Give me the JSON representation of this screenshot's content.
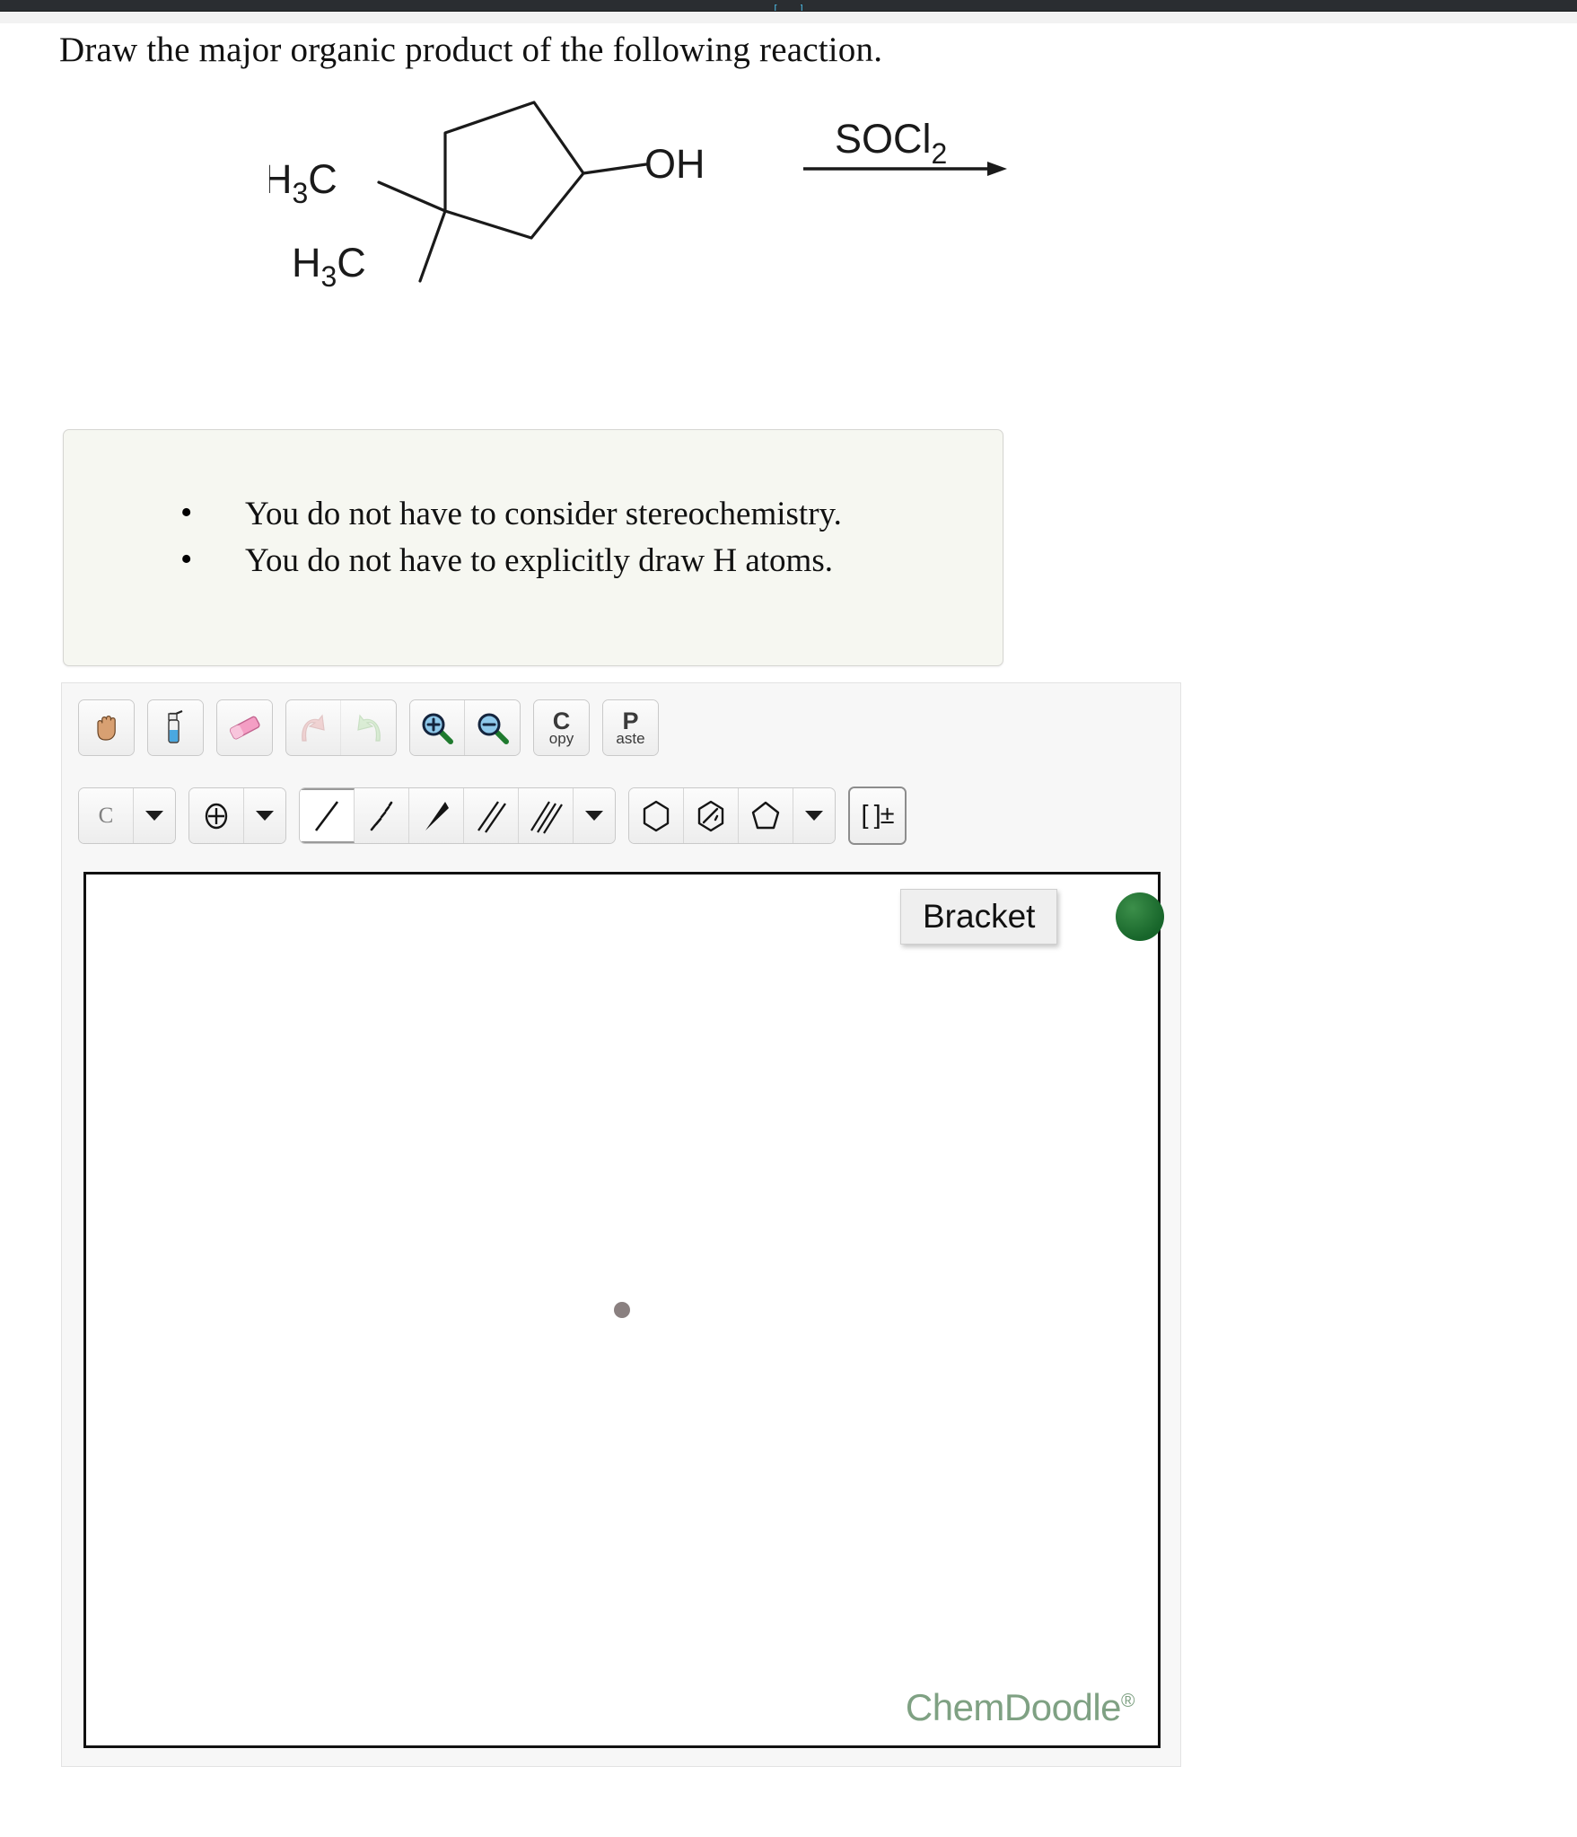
{
  "topbar": {
    "fragments": [
      "[",
      "",
      "",
      "",
      "",
      "",
      "",
      "]"
    ]
  },
  "prompt": {
    "text": "Draw the major organic product of the following reaction."
  },
  "reaction": {
    "substrate_labels": [
      "H3C",
      "H3C",
      "OH"
    ],
    "substrate_label_1_main": "H",
    "substrate_label_1_sub": "3",
    "substrate_label_1_tail": "C",
    "hydroxyl": "OH",
    "reagent_main": "SOCl",
    "reagent_sub": "2",
    "reagent_full": "SOCl2"
  },
  "notes": {
    "bullets": [
      "You do not have to consider stereochemistry.",
      "You do not have to explicitly draw H atoms."
    ]
  },
  "sketcher": {
    "toolbar_row1": [
      {
        "name": "hand-icon",
        "tip": "Move"
      },
      {
        "name": "spray-bottle-icon",
        "tip": "Clear"
      },
      {
        "name": "eraser-icon",
        "tip": "Erase"
      },
      {
        "name": "undo-arrow-icon",
        "tip": "Undo"
      },
      {
        "name": "redo-arrow-icon",
        "tip": "Redo"
      },
      {
        "name": "zoom-in-icon",
        "tip": "Zoom In"
      },
      {
        "name": "zoom-out-icon",
        "tip": "Zoom Out"
      },
      {
        "name": "copy-icon",
        "tip": "Copy",
        "label_main": "C",
        "label_sub": "opy"
      },
      {
        "name": "paste-icon",
        "tip": "Paste",
        "label_main": "P",
        "label_sub": "aste"
      }
    ],
    "toolbar_row2": [
      {
        "name": "element-label",
        "label": "C"
      },
      {
        "name": "element-dropdown-caret"
      },
      {
        "name": "charge-icon"
      },
      {
        "name": "charge-dropdown-caret"
      },
      {
        "name": "single-bond-icon",
        "selected": true
      },
      {
        "name": "hash-wedge-bond-icon"
      },
      {
        "name": "wedge-bond-icon"
      },
      {
        "name": "double-bond-icon"
      },
      {
        "name": "triple-bond-icon"
      },
      {
        "name": "bond-dropdown-caret"
      },
      {
        "name": "benzene-ring-icon"
      },
      {
        "name": "aromatic-ring-icon"
      },
      {
        "name": "cyclopentane-ring-icon"
      },
      {
        "name": "ring-dropdown-caret"
      },
      {
        "name": "bracket-icon",
        "label": "[ ]±",
        "selected": true
      }
    ],
    "tooltip": "Bracket",
    "logo": "ChemDoodle",
    "logo_mark": "®"
  },
  "colors": {
    "topbar_bg": "#2a2d31",
    "topbar_text": "#4ec3f0",
    "note_bg": "#f6f7f1",
    "note_border": "#d6d6d2",
    "panel_bg": "#f7f7f7",
    "canvas_border": "#111111",
    "center_dot": "#8a8080",
    "logo_green": "#7fa183",
    "tooltip_knob_green": "#17652a"
  }
}
